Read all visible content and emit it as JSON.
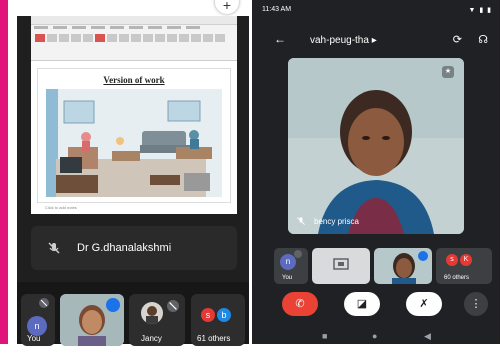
{
  "left_screen": {
    "slide": {
      "title": "Version of work",
      "notes_placeholder": "Click to add notes"
    },
    "speaker_name": "Dr G.dhanalakshmi",
    "participants": [
      {
        "label": "You",
        "avatar_letter": "n",
        "avatar_color": "#5c6bc0"
      },
      {
        "label": "",
        "kind": "video"
      },
      {
        "label": "Jancy",
        "kind": "photo"
      },
      {
        "label": "61 others",
        "avatar_letters": [
          "s",
          "b"
        ],
        "avatar_colors": [
          "#e53935",
          "#1e88e5"
        ]
      }
    ]
  },
  "right_screen": {
    "status_bar": {
      "time": "11:43 AM",
      "indicators": "▼ ▮ ▮"
    },
    "meeting_code": "vah-peug-tha",
    "speaker_name": "bency prisca",
    "participants": [
      {
        "label": "You",
        "avatar_letter": "n",
        "avatar_color": "#5c6bc0"
      },
      {
        "label": "",
        "kind": "screen-share"
      },
      {
        "label": "",
        "kind": "video"
      },
      {
        "label": "60 others",
        "avatar_letters": [
          "s",
          "K"
        ],
        "avatar_colors": [
          "#e53935",
          "#e53935"
        ]
      }
    ],
    "controls": {
      "end_call_color": "#ea4335",
      "control_color": "#ffffff"
    }
  },
  "icons": {
    "mic_off": "mic-off-icon",
    "back": "arrow-back-icon",
    "flip_camera": "flip-camera-icon",
    "audio_output": "headphones-icon",
    "end_call": "end-call-icon",
    "camera_off": "camera-off-icon",
    "more": "more-vertical-icon",
    "pin": "pin-icon"
  }
}
